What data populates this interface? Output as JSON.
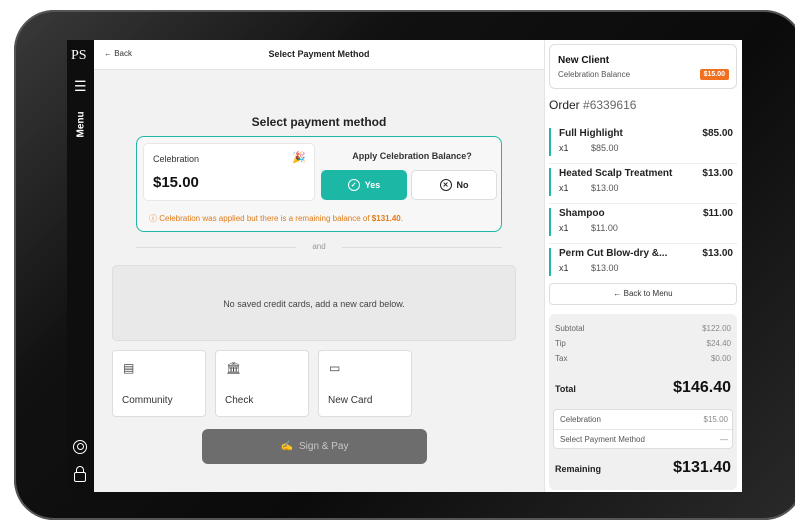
{
  "rail": {
    "logo": "PS",
    "menu_label": "Menu"
  },
  "header": {
    "back_label": "← Back",
    "title": "Select Payment Method"
  },
  "main": {
    "heading": "Select payment method",
    "celebration": {
      "label": "Celebration",
      "amount": "$15.00",
      "apply_question": "Apply Celebration Balance?",
      "yes_label": "Yes",
      "no_label": "No",
      "notice_prefix": "ⓘ Celebration was applied but there is a remaining balance of ",
      "notice_amount": "$131.40",
      "notice_suffix": "."
    },
    "divider_text": "and",
    "no_cards_text": "No saved credit cards, add a new card below.",
    "methods": [
      {
        "label": "Community",
        "icon": "document-icon"
      },
      {
        "label": "Check",
        "icon": "bank-icon"
      },
      {
        "label": "New Card",
        "icon": "credit-card-icon"
      }
    ],
    "sign_pay_label": "Sign & Pay"
  },
  "client": {
    "name": "New Client",
    "subtitle": "Celebration Balance",
    "badge": "$15.00"
  },
  "order": {
    "label": "Order",
    "number": "#6339616"
  },
  "items": [
    {
      "name": "Full Highlight",
      "price": "$85.00",
      "qty": "x1",
      "unit": "$85.00"
    },
    {
      "name": "Heated Scalp Treatment",
      "price": "$13.00",
      "qty": "x1",
      "unit": "$13.00"
    },
    {
      "name": "Shampoo",
      "price": "$11.00",
      "qty": "x1",
      "unit": "$11.00"
    },
    {
      "name": "Perm Cut Blow-dry &...",
      "price": "$13.00",
      "qty": "x1",
      "unit": "$13.00"
    }
  ],
  "back_to_menu": "←  Back to Menu",
  "summary": {
    "subtotal_label": "Subtotal",
    "subtotal": "$122.00",
    "tip_label": "Tip",
    "tip": "$24.40",
    "tax_label": "Tax",
    "tax": "$0.00",
    "total_label": "Total",
    "total": "$146.40",
    "celebration_label": "Celebration",
    "celebration": "$15.00",
    "payment_label": "Select Payment Method",
    "payment": "—",
    "remaining_label": "Remaining",
    "remaining": "$131.40"
  },
  "colors": {
    "accent": "#1db7a6",
    "warning": "#e07b17",
    "badge": "#f07020"
  }
}
